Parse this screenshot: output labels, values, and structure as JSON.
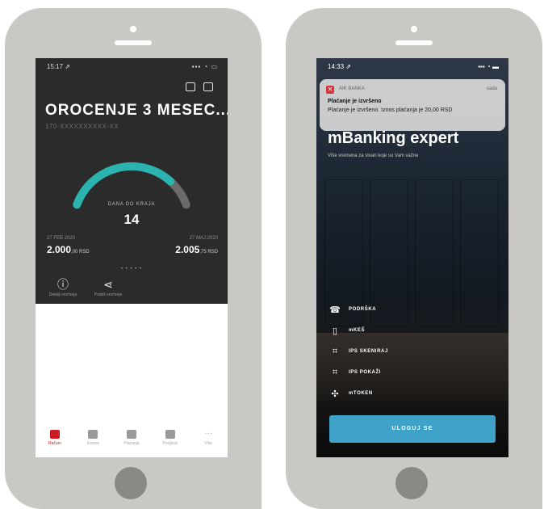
{
  "left_phone": {
    "status_bar": {
      "time": "15:17 ⇗",
      "indicators": "▪▪▪ ◔ ▭"
    },
    "header_icons": [
      "chat-icon",
      "map-icon"
    ],
    "title": "OROCENJE 3 MESEC...",
    "account_number": "170-XXXXXXXXXX-XX",
    "gauge": {
      "label": "DANA DO KRAJA",
      "value": "14",
      "fraction_elapsed": 0.8,
      "color_accent": "#2bb3b0",
      "color_remaining": "#6a6a6a"
    },
    "start": {
      "date": "27 FEB 2020",
      "amount": "2.000",
      "amount_decimals": ",00 RSD"
    },
    "end": {
      "date": "27 MAJ 2020",
      "amount": "2.005",
      "amount_decimals": ",75 RSD"
    },
    "pager": "• • • • •",
    "actions": [
      {
        "icon": "info-icon",
        "glyph": "ⓘ",
        "label": "Detalji oročenja"
      },
      {
        "icon": "share-icon",
        "glyph": "⋖",
        "label": "Podeli oročenje"
      }
    ],
    "tabbar": [
      {
        "label": "Računi",
        "icon": "accounts-icon",
        "active": true
      },
      {
        "label": "Kartice",
        "icon": "card-icon",
        "active": false
      },
      {
        "label": "Plaćanja",
        "icon": "payment-icon",
        "active": false
      },
      {
        "label": "Pregledi",
        "icon": "overview-icon",
        "active": false
      },
      {
        "label": "Više",
        "icon": "more-icon",
        "active": false
      }
    ],
    "tab_more_glyph": "···"
  },
  "right_phone": {
    "status_bar": {
      "time": "14:33 ⇗",
      "indicators": "▪▪▪ ◔ ▬"
    },
    "notification": {
      "app": "AIK BANKA",
      "time": "sada",
      "title": "Plaćanje je izvršeno",
      "body": "Plaćanje je izvršeno. Iznos plaćanja je 20,00 RSD"
    },
    "hero_title": "mBanking expert",
    "hero_subtitle": "Više vremena za stvari koje su Vam važne",
    "menu": [
      {
        "label": "PODRŠKA",
        "icon": "support-icon",
        "glyph": "☎"
      },
      {
        "label": "mKEŠ",
        "icon": "phone-cash-icon",
        "glyph": "▯"
      },
      {
        "label": "IPS SKENIRAJ",
        "icon": "qr-scan-icon",
        "glyph": "⌗"
      },
      {
        "label": "IPS POKAŽI",
        "icon": "qr-show-icon",
        "glyph": "⌗"
      },
      {
        "label": "mTOKEN",
        "icon": "token-icon",
        "glyph": "✣"
      }
    ],
    "login_label": "ULOGUJ SE"
  }
}
